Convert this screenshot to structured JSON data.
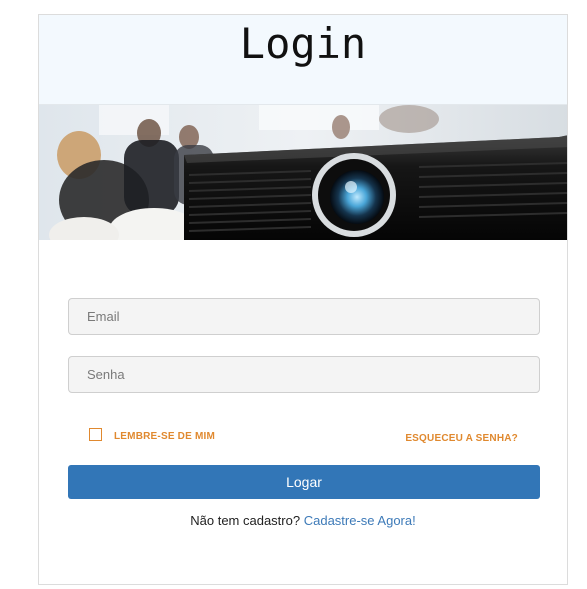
{
  "header": {
    "title": "Login"
  },
  "hero": {
    "image": "projector-meeting-photo"
  },
  "form": {
    "email_placeholder": "Email",
    "password_placeholder": "Senha",
    "remember_label": "LEMBRE-SE DE MIM",
    "remember_checked": false,
    "forgot_label": "ESQUECEU A SENHA?",
    "submit_label": "Logar",
    "signup_prompt": "Não tem cadastro?",
    "signup_link": "Cadastre-se Agora!"
  },
  "colors": {
    "header_bg": "#f3f9fe",
    "accent_orange": "#e0892f",
    "button_blue": "#3276b7",
    "link_blue": "#3d7ab8"
  }
}
